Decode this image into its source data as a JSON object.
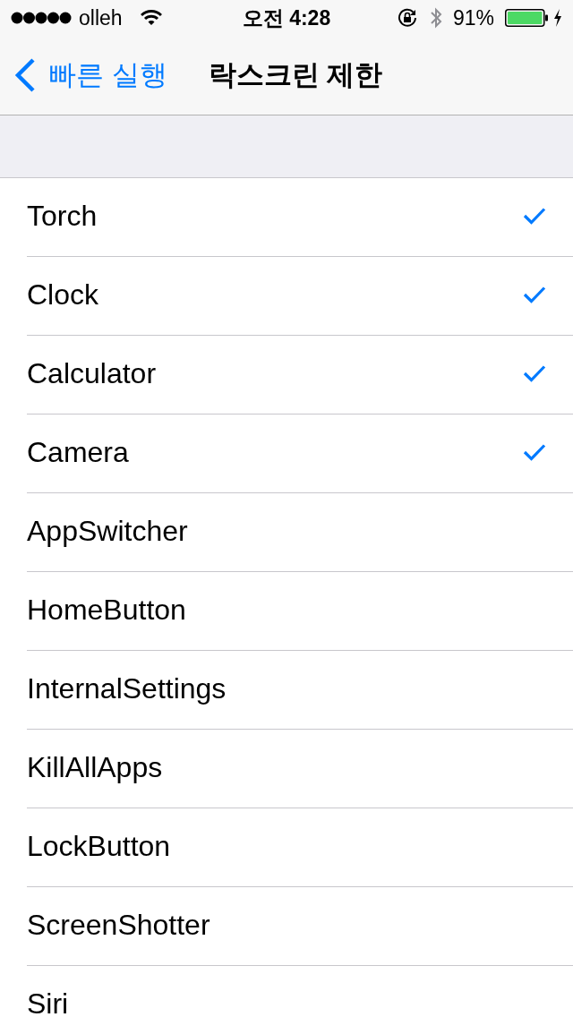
{
  "status_bar": {
    "carrier": "olleh",
    "time": "오전 4:28",
    "battery": "91%"
  },
  "nav_bar": {
    "back": "빠른 실행",
    "title": "락스크린 제한"
  },
  "items": [
    {
      "label": "Torch",
      "checked": true
    },
    {
      "label": "Clock",
      "checked": true
    },
    {
      "label": "Calculator",
      "checked": true
    },
    {
      "label": "Camera",
      "checked": true
    },
    {
      "label": "AppSwitcher",
      "checked": false
    },
    {
      "label": "HomeButton",
      "checked": false
    },
    {
      "label": "InternalSettings",
      "checked": false
    },
    {
      "label": "KillAllApps",
      "checked": false
    },
    {
      "label": "LockButton",
      "checked": false
    },
    {
      "label": "ScreenShotter",
      "checked": false
    },
    {
      "label": "Siri",
      "checked": false
    }
  ]
}
